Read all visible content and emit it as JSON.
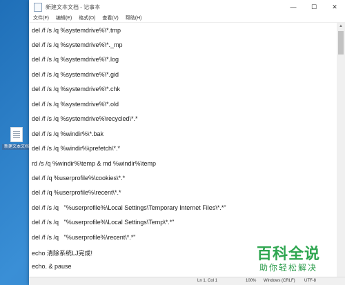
{
  "desktop": {
    "file_icon_label": "新建文本文档"
  },
  "window": {
    "title": "新建文本文档 - 记事本",
    "controls": {
      "minimize": "—",
      "maximize": "☐",
      "close": "✕"
    }
  },
  "menu": [
    "文件(F)",
    "编辑(E)",
    "格式(O)",
    "查看(V)",
    "帮助(H)"
  ],
  "lines": [
    "del /f /s /q %systemdrive%\\*.tmp",
    "del /f /s /q %systemdrive%\\*._mp",
    "del /f /s /q %systemdrive%\\*.log",
    "del /f /s /q %systemdrive%\\*.gid",
    "del /f /s /q %systemdrive%\\*.chk",
    "del /f /s /q %systemdrive%\\*.old",
    "del /f /s /q %systemdrive%\\recycled\\*.*",
    "del /f /s /q %windir%\\*.bak",
    "del /f /s /q %windir%\\prefetch\\*.*",
    "rd /s /q %windir%\\temp & md %windir%\\temp",
    "del /f /q %userprofile%\\cookies\\*.*",
    "del /f /q %userprofile%\\recent\\*.*",
    "del /f /s /q   \"%userprofile%\\Local Settings\\Temporary Internet Files\\*.*\"",
    "del /f /s /q   \"%userprofile%\\Local Settings\\Temp\\*.*\"",
    "del /f /s /q   \"%userprofile%\\recent\\*.*\"",
    "echo 清除系统LJ完成!",
    "echo. & pause"
  ],
  "status": {
    "position": "Ln 1, Col 1",
    "zoom": "100%",
    "line_ending": "Windows (CRLF)",
    "encoding": "UTF-8"
  },
  "watermark": {
    "line1": "百科全说",
    "line2": "助你轻松解决"
  }
}
